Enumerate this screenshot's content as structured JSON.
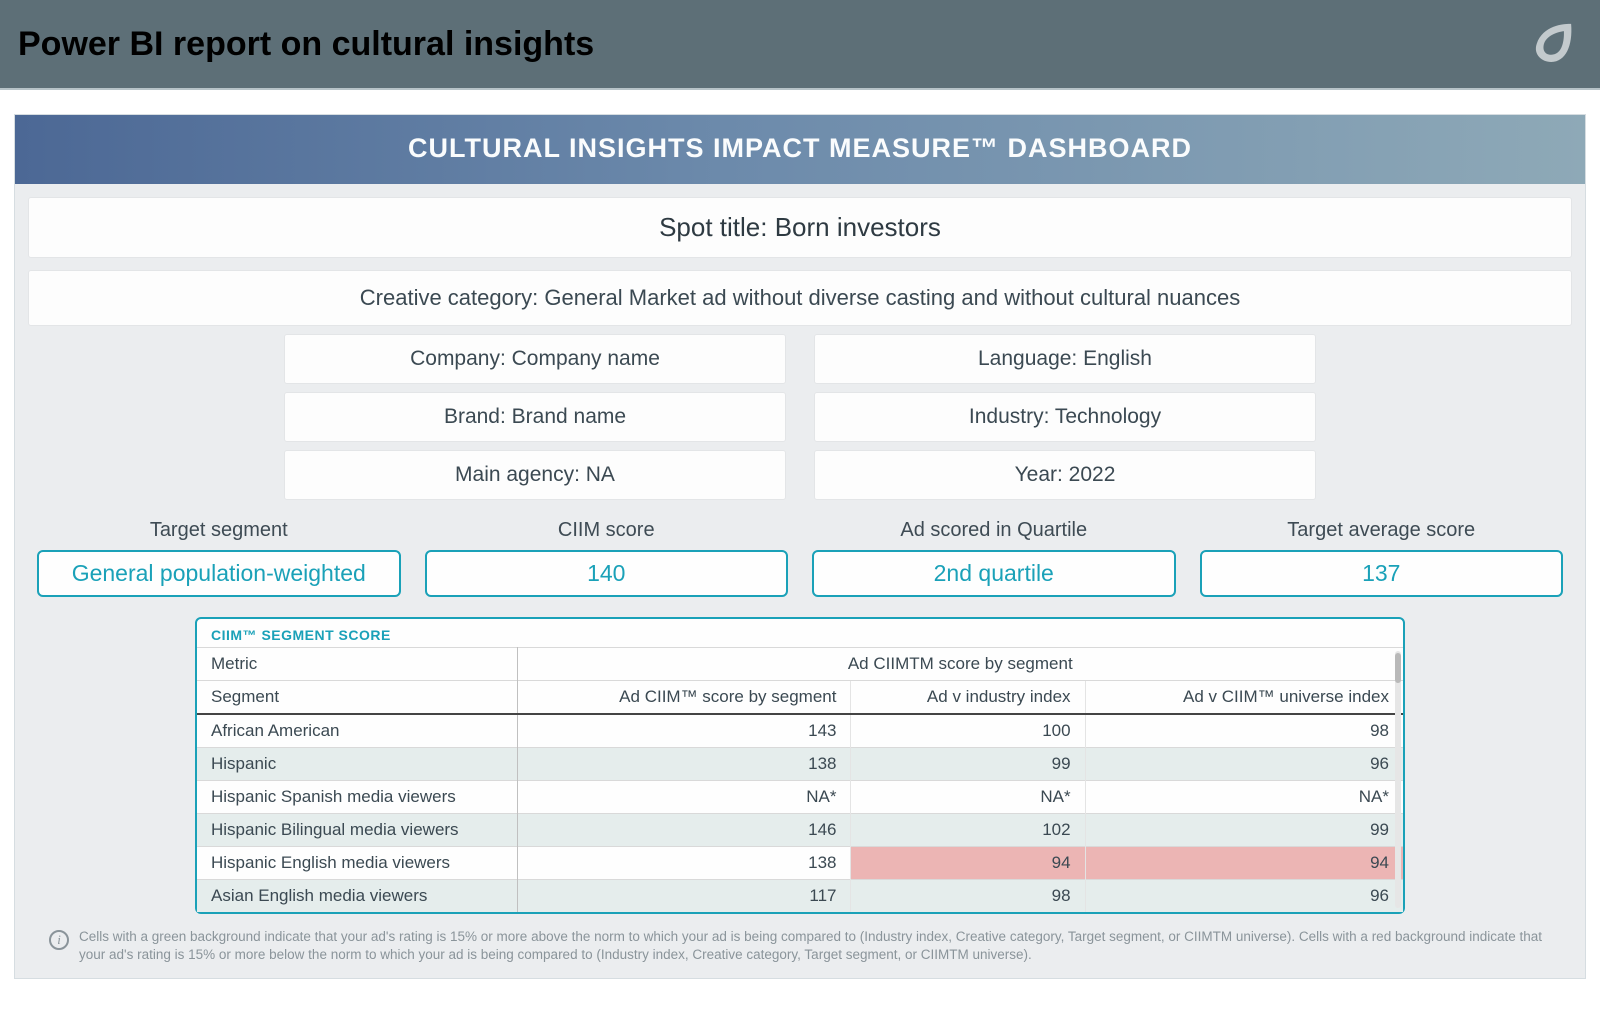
{
  "page_heading": "Power BI report on cultural insights",
  "dashboard_title": "CULTURAL INSIGHTS IMPACT MEASURE™ DASHBOARD",
  "spot_title": "Spot title: Born investors",
  "creative_category": "Creative category: General Market ad without diverse casting and without cultural nuances",
  "meta_left": [
    "Company: Company name",
    "Brand: Brand name",
    "Main agency: NA"
  ],
  "meta_right": [
    "Language: English",
    "Industry: Technology",
    "Year: 2022"
  ],
  "score_labels": [
    "Target segment",
    "CIIM score",
    "Ad scored in Quartile",
    "Target average score"
  ],
  "score_values": [
    "General population-weighted",
    "140",
    "2nd quartile",
    "137"
  ],
  "table_title": "CIIM™ SEGMENT SCORE",
  "table_metric_label": "Metric",
  "table_metric_group": "Ad CIIMTM score by segment",
  "table_segment_label": "Segment",
  "table_cols": [
    "Ad CIIM™ score by segment",
    "Ad v industry index",
    "Ad v CIIM™ universe index"
  ],
  "rows": [
    {
      "seg": "African American",
      "v": [
        "143",
        "100",
        "98"
      ],
      "red": [
        false,
        false,
        false
      ],
      "alt": false
    },
    {
      "seg": "Hispanic",
      "v": [
        "138",
        "99",
        "96"
      ],
      "red": [
        false,
        false,
        false
      ],
      "alt": true
    },
    {
      "seg": "Hispanic Spanish media viewers",
      "v": [
        "NA*",
        "NA*",
        "NA*"
      ],
      "red": [
        false,
        false,
        false
      ],
      "alt": false
    },
    {
      "seg": "Hispanic Bilingual media viewers",
      "v": [
        "146",
        "102",
        "99"
      ],
      "red": [
        false,
        false,
        false
      ],
      "alt": true
    },
    {
      "seg": "Hispanic English media viewers",
      "v": [
        "138",
        "94",
        "94"
      ],
      "red": [
        false,
        true,
        true
      ],
      "alt": false
    },
    {
      "seg": "Asian English media viewers",
      "v": [
        "117",
        "98",
        "96"
      ],
      "red": [
        false,
        false,
        false
      ],
      "alt": true
    }
  ],
  "footnote": "Cells with a green background indicate that your ad's rating is 15% or more above the norm to which your ad is being compared to (Industry index, Creative category, Target segment, or CIIMTM universe). Cells with a red background indicate that your ad's rating is 15% or more below the norm to which your ad is being compared to (Industry index, Creative category, Target segment, or CIIMTM universe)."
}
